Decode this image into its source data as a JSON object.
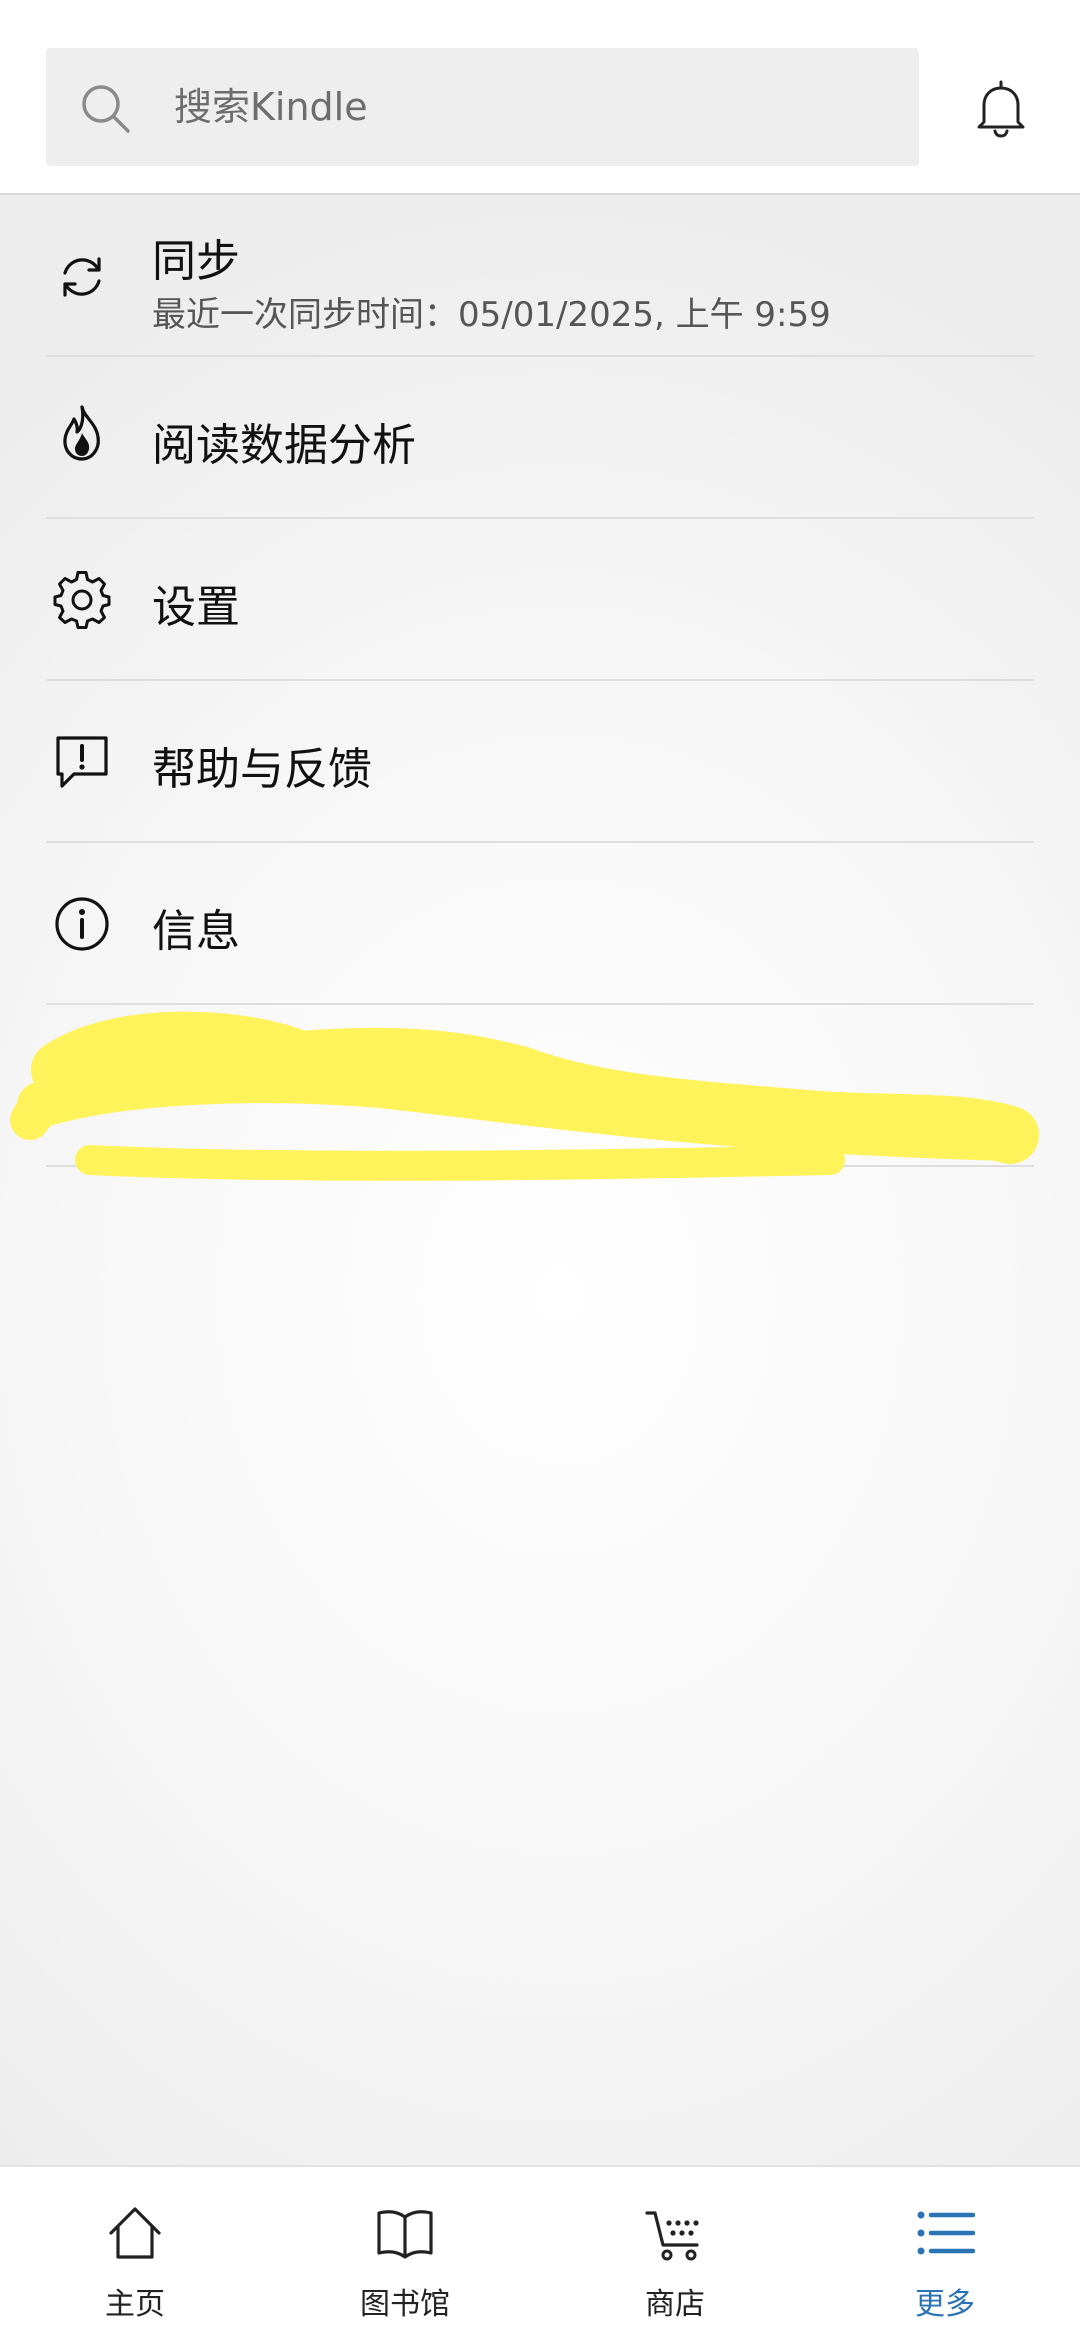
{
  "search": {
    "placeholder": "搜索Kindle"
  },
  "menu": {
    "items": [
      {
        "id": "sync",
        "label": "同步",
        "subtitle": "最近一次同步时间：05/01/2025, 上午 9:59",
        "icon": "sync-icon"
      },
      {
        "id": "reading-insights",
        "label": "阅读数据分析",
        "icon": "flame-icon"
      },
      {
        "id": "settings",
        "label": "设置",
        "icon": "gear-icon"
      },
      {
        "id": "help-feedback",
        "label": "帮助与反馈",
        "icon": "feedback-icon"
      },
      {
        "id": "info",
        "label": "信息",
        "icon": "info-icon"
      },
      {
        "id": "sign-out",
        "label": "",
        "icon": "sign-out-icon",
        "redacted": true
      }
    ]
  },
  "bottom_nav": {
    "items": [
      {
        "label": "主页",
        "icon": "home-icon",
        "active": false
      },
      {
        "label": "图书馆",
        "icon": "book-icon",
        "active": false
      },
      {
        "label": "商店",
        "icon": "cart-icon",
        "active": false
      },
      {
        "label": "更多",
        "icon": "list-icon",
        "active": true
      }
    ]
  },
  "colors": {
    "accent": "#2a73b5",
    "redaction": "#fff35c"
  }
}
